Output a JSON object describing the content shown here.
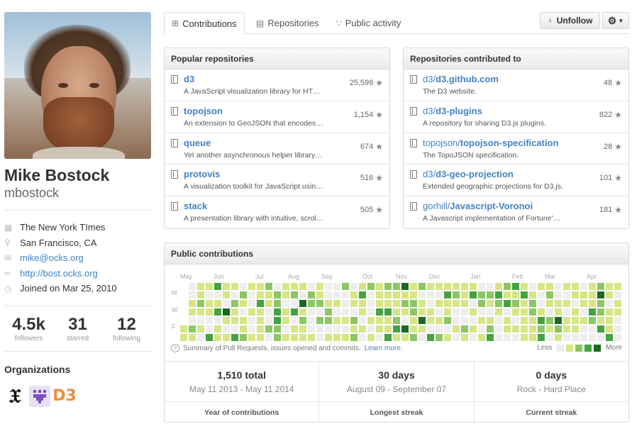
{
  "profile": {
    "fullname": "Mike Bostock",
    "username": "mbostock",
    "details": [
      {
        "icon": "organization-icon",
        "text": "The New York TImes",
        "link": false
      },
      {
        "icon": "location-icon",
        "text": "San Francisco, CA",
        "link": false
      },
      {
        "icon": "mail-icon",
        "text": "mike@ocks.org",
        "link": true
      },
      {
        "icon": "link-icon",
        "text": "http://bost.ocks.org",
        "link": true
      },
      {
        "icon": "clock-icon",
        "text": "Joined on Mar 25, 2010",
        "link": false
      }
    ],
    "stats": [
      {
        "value": "4.5k",
        "label": "followers"
      },
      {
        "value": "31",
        "label": "starred"
      },
      {
        "value": "12",
        "label": "following"
      }
    ],
    "orgs_title": "Organizations",
    "orgs": [
      "nytimes-logo",
      "purple-org-logo",
      "d3-logo"
    ],
    "org_d3_text": "D3"
  },
  "tabs": [
    {
      "label": "Contributions",
      "icon": "contributions-icon",
      "selected": true
    },
    {
      "label": "Repositories",
      "icon": "repo-icon",
      "selected": false
    },
    {
      "label": "Public activity",
      "icon": "rss-icon",
      "selected": false
    }
  ],
  "actions": {
    "unfollow_label": "Unfollow",
    "settings_icon": "gear-icon"
  },
  "popular": {
    "title": "Popular repositories",
    "repos": [
      {
        "name": "d3",
        "desc": "A JavaScript visualization library for HT…",
        "stars": "25,599"
      },
      {
        "name": "topojson",
        "desc": "An extension to GeoJSON that encodes…",
        "stars": "1,154"
      },
      {
        "name": "queue",
        "desc": "Yet another asynchronous helper library…",
        "stars": "674"
      },
      {
        "name": "protovis",
        "desc": "A visualization toolkit for JavaScript usin…",
        "stars": "516"
      },
      {
        "name": "stack",
        "desc": "A presentation library with intuitive, scrol…",
        "stars": "505"
      }
    ]
  },
  "contributed": {
    "title": "Repositories contributed to",
    "repos": [
      {
        "owner": "d3/",
        "name": "d3.github.com",
        "desc": "The D3 website.",
        "stars": "48"
      },
      {
        "owner": "d3/",
        "name": "d3-plugins",
        "desc": "A repository for sharing D3.js plugins.",
        "stars": "822"
      },
      {
        "owner": "topojson/",
        "name": "topojson-specification",
        "desc": "The TopoJSON specification.",
        "stars": "28"
      },
      {
        "owner": "d3/",
        "name": "d3-geo-projection",
        "desc": "Extended geographic projections for D3.js.",
        "stars": "101"
      },
      {
        "owner": "gorhill/",
        "name": "Javascript-Voronoi",
        "desc": "A Javascript implementation of Fortune'…",
        "stars": "181"
      }
    ]
  },
  "contributions": {
    "title": "Public contributions",
    "months": [
      "May",
      "Jun",
      "Jul",
      "Aug",
      "Sep",
      "Oct",
      "Nov",
      "Dec",
      "Jan",
      "Feb",
      "Mar",
      "Apr"
    ],
    "days": [
      "M",
      "W",
      "F"
    ],
    "note": "Summary of Pull Requests, issues opened and commits.",
    "learn_more": "Learn more.",
    "legend_less": "Less",
    "legend_more": "More",
    "colors": [
      "#eeeeee",
      "#d6e685",
      "#8cc665",
      "#44a340",
      "#1e6823"
    ],
    "summary": [
      {
        "big": "1,510 total",
        "range": "May 11 2013 - May 11 2014",
        "caption": "Year of contributions"
      },
      {
        "big": "30 days",
        "range": "August 09 - September 07",
        "caption": "Longest streak"
      },
      {
        "big": "0 days",
        "range": "Rock - Hard Place",
        "caption": "Current streak"
      }
    ]
  }
}
